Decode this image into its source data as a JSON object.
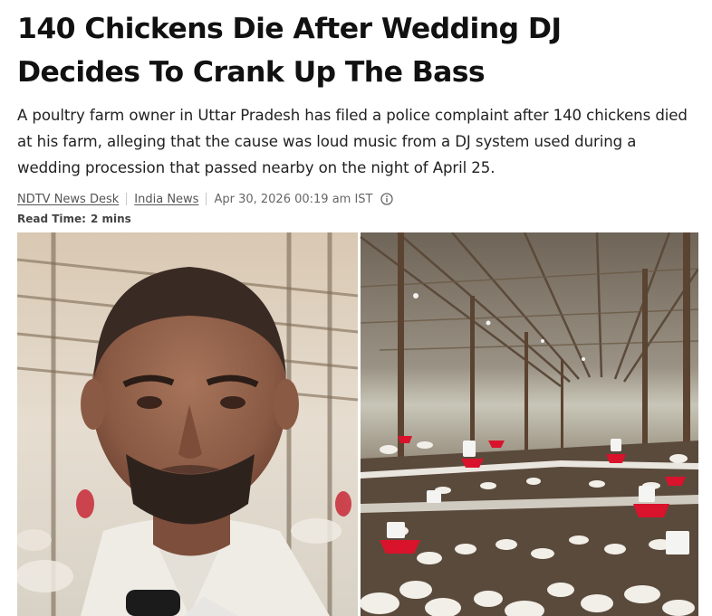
{
  "article": {
    "headline_line1": "140 Chickens Die After Wedding DJ",
    "headline_line2": "Decides To Crank Up The Bass",
    "summary": "A poultry farm owner in Uttar Pradesh has filed a police complaint after 140 chickens died at his farm, alleging that the cause was loud music from a DJ system used during a wedding procession that passed nearby on the night of April 25.",
    "author": "NDTV News Desk",
    "category": "India News",
    "timestamp": "Apr 30, 2026 00:19 am IST",
    "read_time_label": "Read Time:",
    "read_time_value": "2 mins"
  },
  "photo": {
    "left_panel": "farm-owner-portrait",
    "right_panel": "poultry-shed-with-chickens"
  },
  "colors": {
    "link": "#555555",
    "meta_text": "#666666",
    "feeder_red": "#d8132b"
  },
  "icons": {
    "info": "info-circle-icon"
  }
}
